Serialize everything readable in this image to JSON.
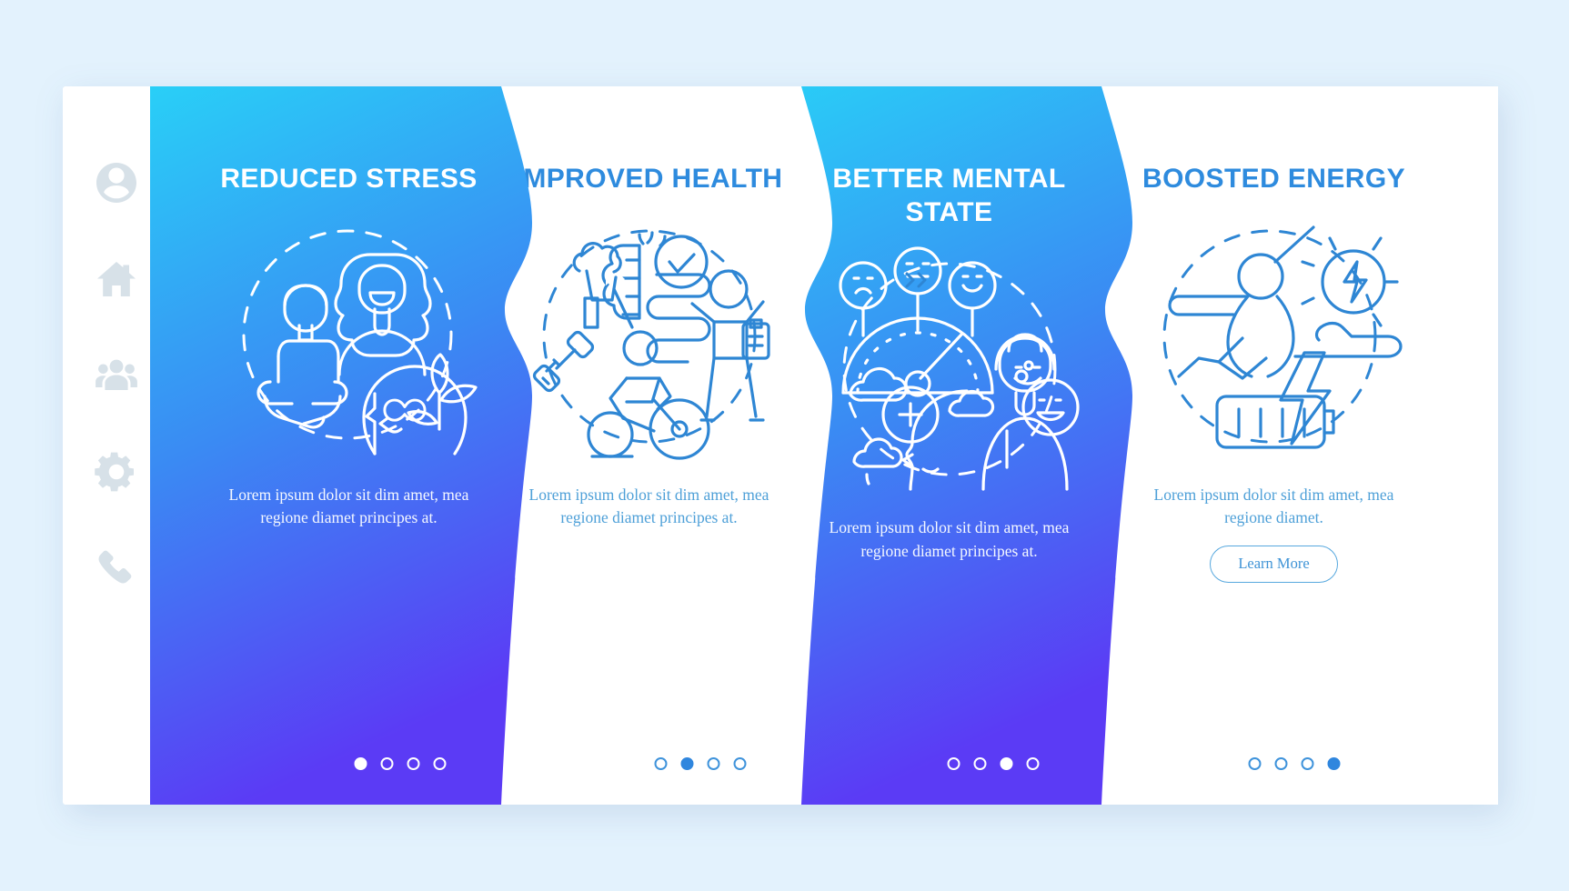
{
  "page": {
    "background_color": "#E3F2FD",
    "card_background": "#FFFFFF"
  },
  "sidebar": {
    "items": [
      {
        "icon": "user-avatar-icon",
        "label": "Profile"
      },
      {
        "icon": "home-icon",
        "label": "Home"
      },
      {
        "icon": "people-group-icon",
        "label": "Community"
      },
      {
        "icon": "gear-icon",
        "label": "Settings"
      },
      {
        "icon": "phone-icon",
        "label": "Contact"
      }
    ]
  },
  "theme": {
    "gradient_top": "#29CFF7",
    "gradient_bottom": "#5B3BF5",
    "title_blue": "#2E8BDE",
    "body_blue": "#4EA0D8",
    "icon_grey": "#D7E1E8",
    "page_bg": "#E3F2FD"
  },
  "chevrons": [
    {
      "name": "chevron-next-1",
      "glyph": "double-chevron-right",
      "color": "#FFFFFF"
    },
    {
      "name": "chevron-next-2",
      "glyph": "double-chevron-right",
      "color": "#2E86D4"
    },
    {
      "name": "chevron-next-3",
      "glyph": "double-chevron-right",
      "color": "#FFFFFF"
    }
  ],
  "panels": [
    {
      "id": "reduced-stress",
      "style": "blue",
      "title": "REDUCED STRESS",
      "description": "Lorem ipsum dolor sit dim amet, mea regione diamet principes at.",
      "illustration": "meditation-wellness-icon",
      "dots": {
        "count": 4,
        "active": 1
      },
      "button": null
    },
    {
      "id": "improved-health",
      "style": "white",
      "title": "IMPROVED HEALTH",
      "description": "Lorem ipsum dolor sit dim amet, mea regione diamet principes at.",
      "illustration": "fitness-nutrition-icon",
      "dots": {
        "count": 4,
        "active": 2
      },
      "button": null
    },
    {
      "id": "better-mental-state",
      "style": "blue",
      "title": "BETTER MENTAL STATE",
      "description": "Lorem ipsum dolor sit dim amet, mea regione diamet principes at.",
      "illustration": "mood-meter-icon",
      "dots": {
        "count": 4,
        "active": 3
      },
      "button": null
    },
    {
      "id": "boosted-energy",
      "style": "white",
      "title": "BOOSTED ENERGY",
      "description": "Lorem ipsum dolor sit dim amet, mea regione diamet.",
      "illustration": "energy-battery-icon",
      "dots": {
        "count": 4,
        "active": 4
      },
      "button": "Learn More"
    }
  ]
}
